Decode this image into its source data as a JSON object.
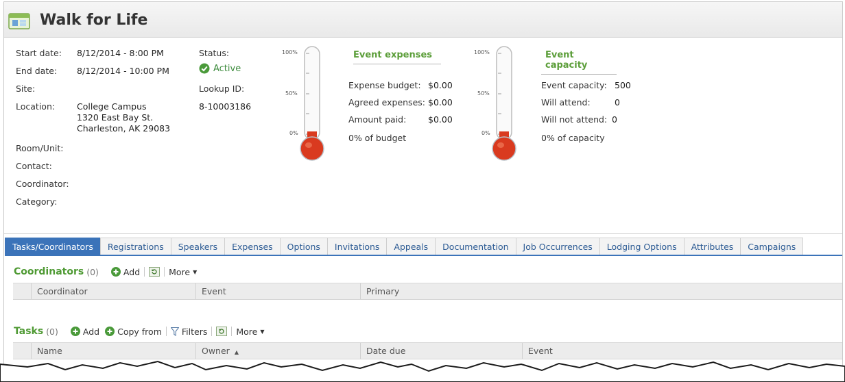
{
  "page": {
    "title": "Walk for Life",
    "icon": "calendar-event-icon"
  },
  "details": {
    "start_date_label": "Start date:",
    "start_date": "8/12/2014 - 8:00 PM",
    "end_date_label": "End date:",
    "end_date": "8/12/2014 - 10:00 PM",
    "site_label": "Site:",
    "location_label": "Location:",
    "location_line1": "College Campus",
    "location_line2": "1320 East Bay St.",
    "location_line3": "Charleston, AK  29083",
    "room_label": "Room/Unit:",
    "contact_label": "Contact:",
    "coordinator_label": "Coordinator:",
    "category_label": "Category:",
    "status_label": "Status:",
    "status_value": "Active",
    "lookup_label": "Lookup ID:",
    "lookup_value": "8-10003186"
  },
  "expenses": {
    "title": "Event expenses",
    "budget_label": "Expense budget:",
    "budget_value": "$0.00",
    "agreed_label": "Agreed expenses:",
    "agreed_value": "$0.00",
    "paid_label": "Amount paid:",
    "paid_value": "$0.00",
    "summary": "0% of budget",
    "fill_fraction": 0
  },
  "capacity": {
    "title": "Event capacity",
    "capacity_label": "Event capacity:",
    "capacity_value": "500",
    "attend_label": "Will attend:",
    "attend_value": "0",
    "not_attend_label": "Will not attend:",
    "not_attend_value": "0",
    "summary": "0% of capacity",
    "fill_fraction": 0
  },
  "thermometer_scale": {
    "top": "100%",
    "mid": "50%",
    "bottom": "0%"
  },
  "tabs": [
    {
      "label": "Tasks/Coordinators"
    },
    {
      "label": "Registrations"
    },
    {
      "label": "Speakers"
    },
    {
      "label": "Expenses"
    },
    {
      "label": "Options"
    },
    {
      "label": "Invitations"
    },
    {
      "label": "Appeals"
    },
    {
      "label": "Documentation"
    },
    {
      "label": "Job Occurrences"
    },
    {
      "label": "Lodging Options"
    },
    {
      "label": "Attributes"
    },
    {
      "label": "Campaigns"
    }
  ],
  "coordinators": {
    "title": "Coordinators",
    "count": "(0)",
    "add_label": "Add",
    "more_label": "More",
    "columns": [
      "Coordinator",
      "Event",
      "Primary"
    ]
  },
  "tasks": {
    "title": "Tasks",
    "count": "(0)",
    "add_label": "Add",
    "copy_label": "Copy from",
    "filters_label": "Filters",
    "more_label": "More",
    "columns": [
      "Name",
      "Owner",
      "Date due",
      "Event"
    ]
  },
  "colors": {
    "accent_green": "#5c9e3a",
    "tab_blue": "#3b73b9",
    "thermometer_red": "#d93a1f"
  }
}
